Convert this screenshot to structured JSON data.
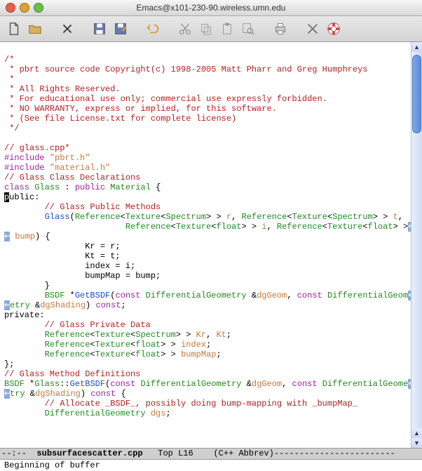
{
  "window": {
    "title": "Emacs@x101-230-90.wireless.umn.edu"
  },
  "traffic": {
    "close": "#e8604c",
    "min": "#e0a030",
    "zoom": "#68c047"
  },
  "code": {
    "l1": "/*",
    "l2": " * pbrt source code Copyright(c) 1998-2005 Matt Pharr and Greg Humphreys",
    "l3": " *",
    "l4": " * All Rights Reserved.",
    "l5": " * For educational use only; commercial use expressly forbidden.",
    "l6": " * NO WARRANTY, express or implied, for this software.",
    "l7": " * (See file License.txt for complete license)",
    "l8": " */",
    "l10": "// glass.cpp*",
    "inc": "#include ",
    "inc1": "\"pbrt.h\"",
    "inc2": "\"material.h\"",
    "l13": "// Glass Class Declarations",
    "kw_class": "class ",
    "type_glass": "Glass",
    "kw_pub_mat": " : ",
    "kw_public": "public ",
    "type_mat": "Material",
    "brace_open": " {",
    "pub_cursor": "p",
    "pub_rest": "ublic:",
    "l16": "        // Glass Public Methods",
    "l17a": "        ",
    "l17b": "Glass",
    "l17c": "(",
    "l17d": "Reference",
    "l17e": "<",
    "l17f": "Texture",
    "l17g": "<",
    "l17h": "Spectrum",
    "l17i": "> > ",
    "l17j": "r",
    "l17k": ", ",
    "l17l": "Reference",
    "l17m": "<",
    "l17n": "Texture",
    "l17o": "<",
    "l17p": "Spectrum",
    "l17q": "> > ",
    "l17r": "t",
    "l17s": ",",
    "l18a": "                        ",
    "l18b": "Reference",
    "l18c": "<",
    "l18d": "Texture",
    "l18e": "<",
    "l18f": "float",
    "l18g": "> > ",
    "l18h": "i",
    "l18i": ", ",
    "l18j": "Reference",
    "l18k": "<",
    "l18l": "Texture",
    "l18m": "<",
    "l18n": "float",
    "l18o": "> >",
    "l19a": " ",
    "l19b": "bump",
    "l19c": ") {",
    "l20": "                Kr = r;",
    "l21": "                Kt = t;",
    "l22": "                index = i;",
    "l23": "                bumpMap = bump;",
    "l24": "        }",
    "l25a": "        ",
    "l25b": "BSDF",
    "l25c": " *",
    "l25d": "GetBSDF",
    "l25e": "(",
    "l25f": "const ",
    "l25g": "DifferentialGeometry",
    "l25h": " &",
    "l25i": "dgGeom",
    "l25j": ", ",
    "l25k": "const ",
    "l25l": "DifferentialGeom",
    "l26a": "etry",
    "l26b": " &",
    "l26c": "dgShading",
    "l26d": ") ",
    "l26e": "const",
    "l26f": ";",
    "priv": "private:",
    "l28": "        // Glass Private Data",
    "l29a": "        ",
    "l29b": "Reference",
    "l29c": "<",
    "l29d": "Texture",
    "l29e": "<",
    "l29f": "Spectrum",
    "l29g": "> > ",
    "l29h": "Kr",
    "l29i": ", ",
    "l29j": "Kt",
    "l29k": ";",
    "l30a": "        ",
    "l30b": "Reference",
    "l30c": "<",
    "l30d": "Texture",
    "l30e": "<",
    "l30f": "float",
    "l30g": "> > ",
    "l30h": "index",
    "l30i": ";",
    "l31a": "        ",
    "l31b": "Reference",
    "l31c": "<",
    "l31d": "Texture",
    "l31e": "<",
    "l31f": "float",
    "l31g": "> > ",
    "l31h": "bumpMap",
    "l31i": ";",
    "l32": "};",
    "l33": "// Glass Method Definitions",
    "l34a": "BSDF",
    "l34b": " *",
    "l34c": "Glass",
    "l34d": "::",
    "l34e": "GetBSDF",
    "l34f": "(",
    "l34g": "const ",
    "l34h": "DifferentialGeometry",
    "l34i": " &",
    "l34j": "dgGeom",
    "l34k": ", ",
    "l34l": "const ",
    "l34m": "DifferentialGeome",
    "l35a": "try",
    "l35b": " &",
    "l35c": "dgShading",
    "l35d": ") ",
    "l35e": "const ",
    "l35f": "{",
    "l36": "        // Allocate _BSDF_, possibly doing bump-mapping with _bumpMap_",
    "l37a": "        ",
    "l37b": "DifferentialGeometry",
    "l37c": " ",
    "l37d": "dgs",
    "l37e": ";"
  },
  "contmark": "↩",
  "modeline": "--:--  subsurfacescatter.cpp   Top L16    (C++ Abbrev)------------------------",
  "modeline_pre": "--:--  ",
  "modeline_buf": "subsurfacescatter.cpp",
  "modeline_post": "   Top L16    (C++ Abbrev)------------------------",
  "minibuffer": "Beginning of buffer"
}
